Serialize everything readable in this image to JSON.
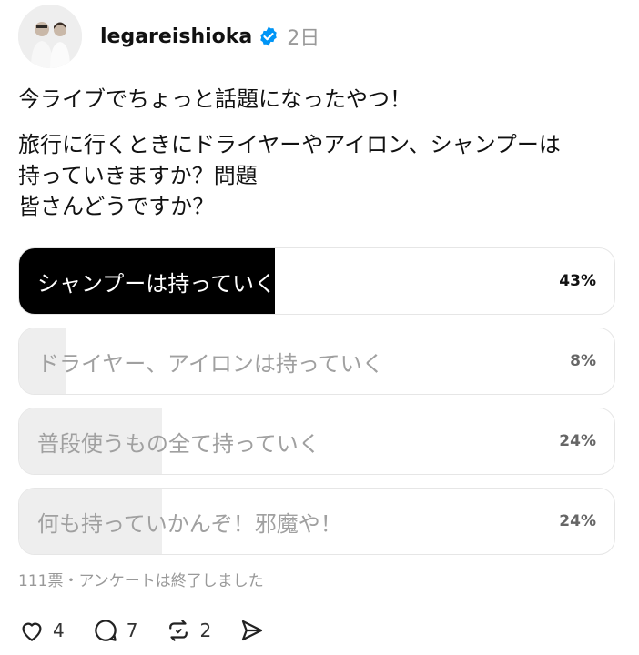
{
  "post": {
    "username": "legareishioka",
    "time": "2日",
    "lines": [
      "今ライブでちょっと話題になったやつ！",
      "旅行に行くときにドライヤーやアイロン、シャンプーは",
      "持っていきますか？問題",
      "皆さんどうですか？"
    ]
  },
  "poll": {
    "options": [
      {
        "label": "シャンプーは持っていく",
        "percent_text": "43%",
        "percent": 43,
        "winner": true
      },
      {
        "label": "ドライヤー、アイロンは持っていく",
        "percent_text": "8%",
        "percent": 8,
        "winner": false
      },
      {
        "label": "普段使うもの全て持っていく",
        "percent_text": "24%",
        "percent": 24,
        "winner": false
      },
      {
        "label": "何も持っていかんぞ！邪魔や！",
        "percent_text": "24%",
        "percent": 24,
        "winner": false
      }
    ],
    "meta": "111票・アンケートは終了しました"
  },
  "actions": {
    "likes": "4",
    "replies": "7",
    "reposts": "2"
  },
  "icons": {
    "verified": "verified-badge-icon",
    "like": "heart-icon",
    "reply": "reply-bubble-icon",
    "repost": "repost-icon",
    "share": "send-icon"
  },
  "colors": {
    "verified": "#0095f6",
    "winner_fill": "#000000",
    "option_fill": "#eeeeee"
  }
}
